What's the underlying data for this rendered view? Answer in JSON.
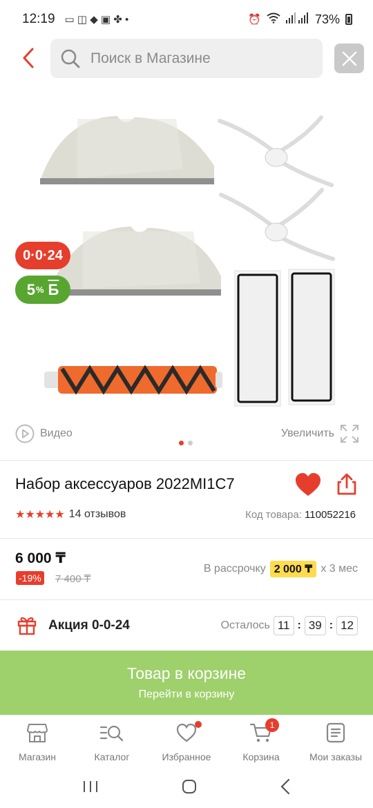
{
  "status_bar": {
    "time": "12:19",
    "battery": "73%"
  },
  "search": {
    "placeholder": "Поиск в Магазине"
  },
  "gallery": {
    "promo_badge": "0·0·24",
    "bonus_badge": "5",
    "bonus_unit": "%",
    "bonus_symbol": "Б",
    "video_label": "Видео",
    "zoom_label": "Увеличить",
    "slides_total": 2,
    "active_slide": 1
  },
  "product": {
    "title": "Набор аксессуаров 2022MI1C7",
    "rating": 5,
    "reviews": "14 отзывов",
    "sku_label": "Код товара:",
    "sku_value": "110052216"
  },
  "price": {
    "current": "6 000 ₸",
    "discount": "-19%",
    "old": "7 400 ₸",
    "installment_prefix": "В рассрочку",
    "installment_amount": "2 000 ₸",
    "installment_suffix": "х 3 мес"
  },
  "promo": {
    "title": "Акция 0-0-24",
    "timer_label": "Осталось",
    "hours": "11",
    "minutes": "39",
    "seconds": "12"
  },
  "cart_button": {
    "title": "Товар в корзине",
    "subtitle": "Перейти в корзину"
  },
  "bottom_nav": {
    "items": [
      {
        "label": "Магазин",
        "icon": "store-icon"
      },
      {
        "label": "Каталог",
        "icon": "catalog-search-icon"
      },
      {
        "label": "Избранное",
        "icon": "heart-outline-icon"
      },
      {
        "label": "Корзина",
        "icon": "cart-icon",
        "badge": "1"
      },
      {
        "label": "Мои заказы",
        "icon": "orders-list-icon"
      }
    ]
  },
  "colors": {
    "accent_red": "#e63e2c",
    "bonus_green": "#58a630",
    "cart_green": "#9ed06b",
    "installment_yellow": "#ffdb4d"
  }
}
